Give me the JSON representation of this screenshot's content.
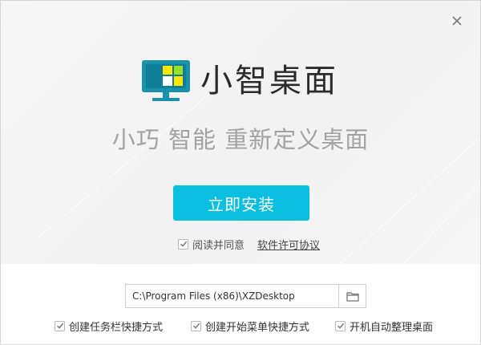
{
  "window": {
    "close_icon": "close-icon"
  },
  "brand": {
    "title": "小智桌面",
    "logo_icon": "monitor-logo-icon"
  },
  "tagline": "小巧 智能 重新定义桌面",
  "install": {
    "label": "立即安装"
  },
  "agreement": {
    "checked": true,
    "label": "阅读并同意",
    "link_label": "软件许可协议"
  },
  "install_path": {
    "value": "C:\\Program Files (x86)\\XZDesktop",
    "browse_icon": "folder-icon"
  },
  "options": [
    {
      "label": "创建任务栏快捷方式",
      "checked": true
    },
    {
      "label": "创建开始菜单快捷方式",
      "checked": true
    },
    {
      "label": "开机自动整理桌面",
      "checked": true
    }
  ],
  "colors": {
    "accent": "#0abfe0",
    "logo_yellow": "#ffe600",
    "logo_green": "#9be02a",
    "logo_frame": "#1b92ad"
  }
}
